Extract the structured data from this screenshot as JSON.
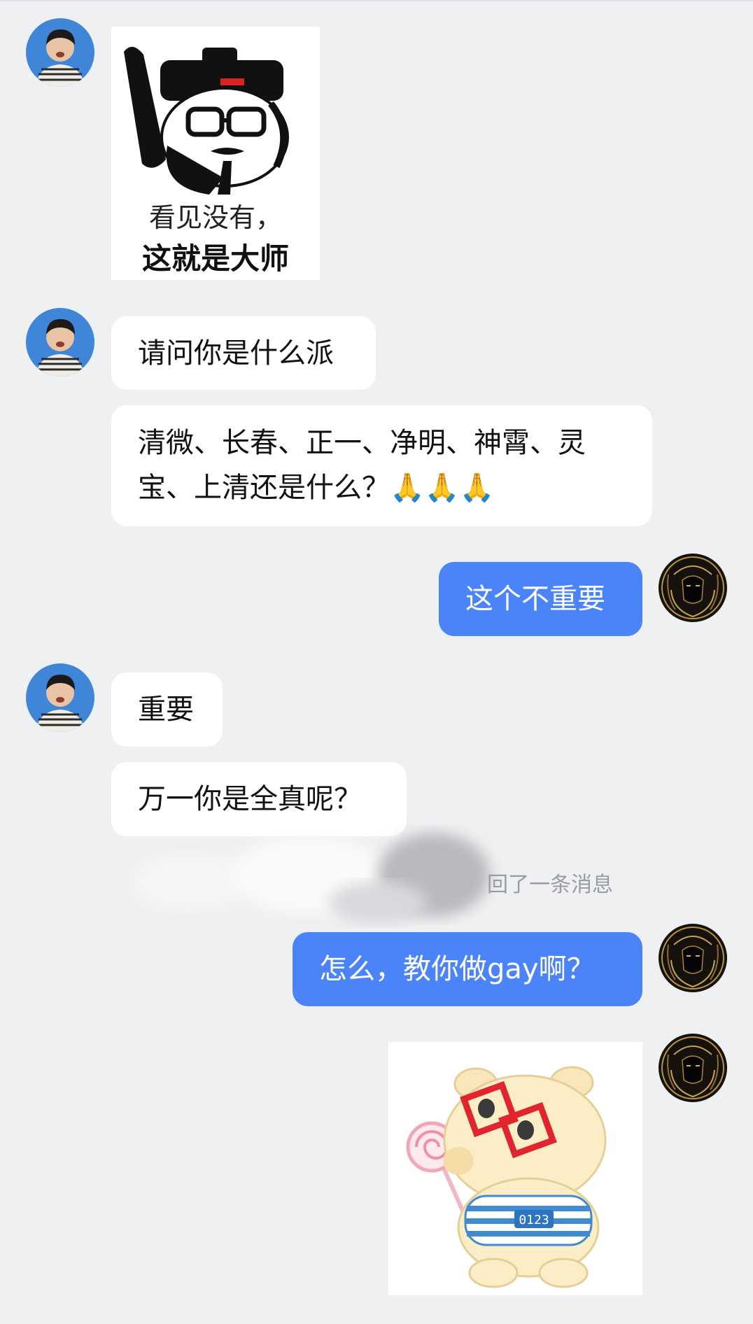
{
  "chat": {
    "messages": [
      {
        "side": "left",
        "kind": "sticker",
        "caption_line1": "看见没有，",
        "caption_line2": "这就是大师"
      },
      {
        "side": "left",
        "kind": "text",
        "text": "请问你是什么派"
      },
      {
        "side": "left",
        "kind": "text",
        "line1": "清微、长春、正一、净明、神霄、灵",
        "line2": "宝、上清还是什么？🙏🙏🙏"
      },
      {
        "side": "right",
        "kind": "text",
        "text": "这个不重要"
      },
      {
        "side": "left",
        "kind": "text",
        "text": "重要"
      },
      {
        "side": "left",
        "kind": "text",
        "text": "万一你是全真呢？"
      },
      {
        "side": "system",
        "kind": "notice",
        "text": "回了一条消息"
      },
      {
        "side": "right",
        "kind": "text",
        "text": "怎么，教你做gay啊？"
      },
      {
        "side": "right",
        "kind": "sticker",
        "badge": "0123"
      }
    ]
  },
  "colors": {
    "background": "#eff0f2",
    "incoming_bubble": "#ffffff",
    "outgoing_bubble": "#4b84f8",
    "system_text": "#9a9ca3"
  },
  "icons": {
    "contact_avatar": "avatar-boy-photo",
    "self_avatar": "avatar-dark-gold-portrait"
  }
}
